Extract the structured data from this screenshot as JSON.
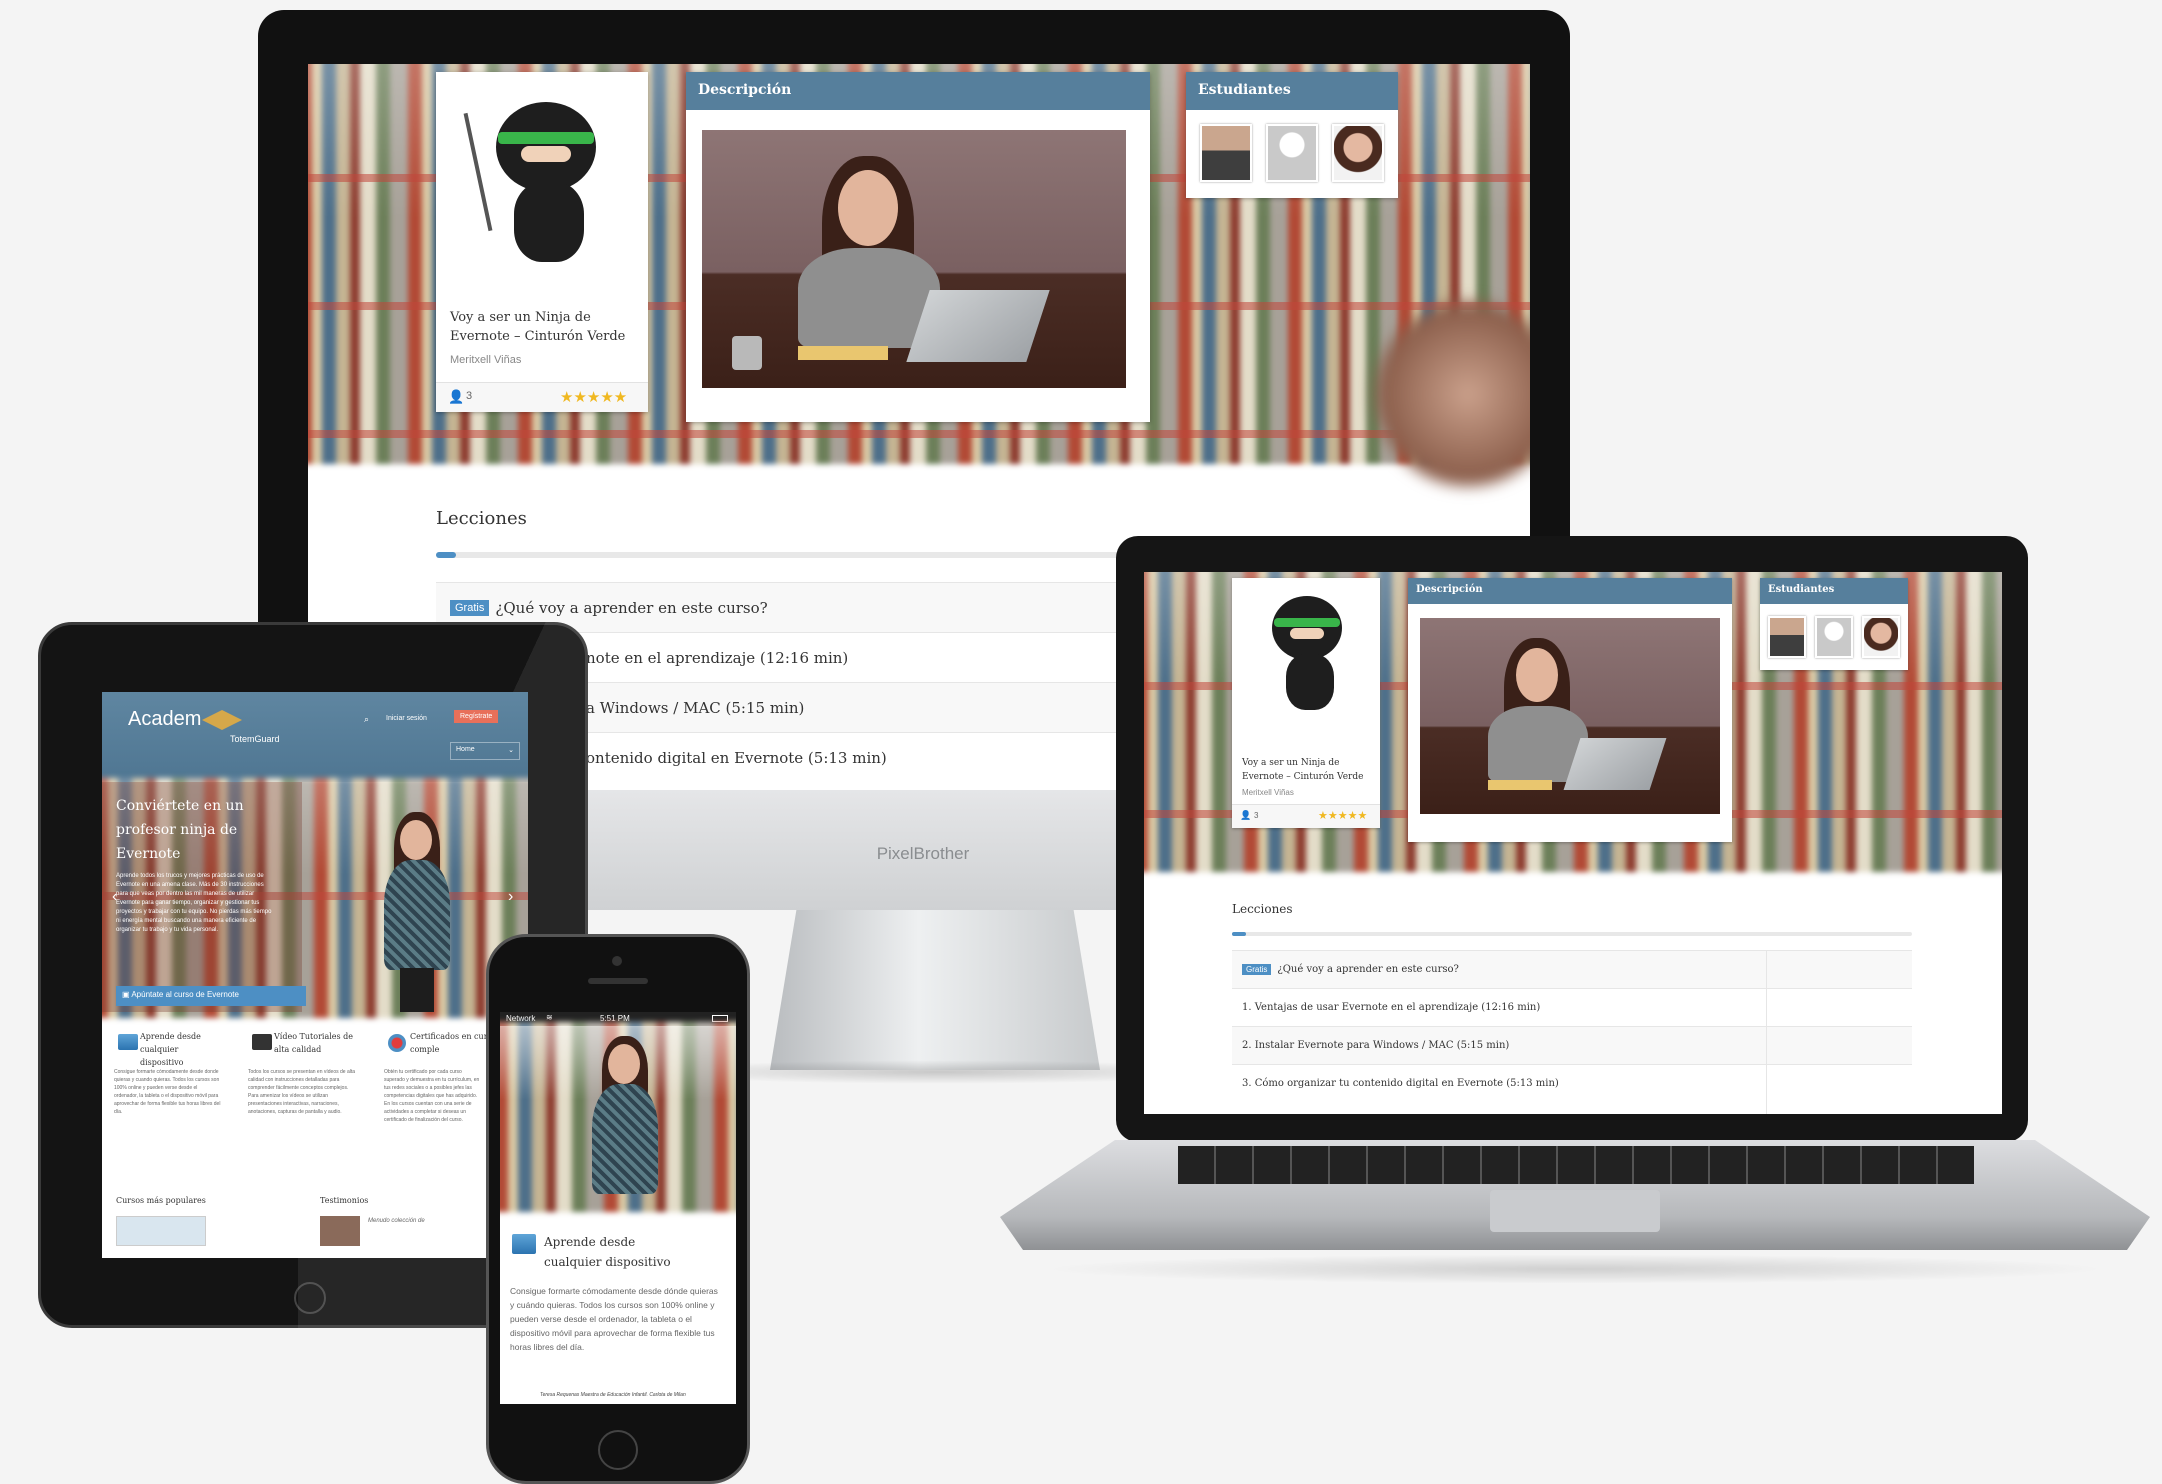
{
  "course": {
    "title": "Voy a ser un Ninja de Evernote – Cinturón Verde",
    "author": "Meritxell Viñas",
    "students_count": "3",
    "rating": "★★★★★",
    "description_label": "Descripción",
    "students_label": "Estudiantes"
  },
  "lessons": {
    "heading": "Lecciones",
    "free_badge": "Gratis",
    "items": [
      "¿Qué voy a aprender en este curso?",
      "1. Ventajas de usar Evernote en el aprendizaje (12:16 min)",
      "2. Instalar Evernote para Windows / MAC (5:15 min)",
      "3. Cómo organizar tu contenido digital en Evernote (5:13 min)"
    ],
    "desktop_visible": [
      "¿Qué voy a aprender en este curso?",
      "note en el aprendizaje (12:16 min)",
      "a Windows / MAC (5:15 min)",
      "ontenido digital en Evernote (5:13 min)"
    ]
  },
  "monitor": {
    "brand": "PixelBrother"
  },
  "tablet": {
    "logo_main": "Academ",
    "logo_sub": "TotemGuard",
    "login": "Iniciar sesión",
    "register": "Regístrate",
    "nav_select": "Home",
    "hero_title": "Conviértete en un profesor ninja de Evernote",
    "hero_text": "Aprende todos los trucos y mejores prácticas de uso de Evernote en una amena clase. Más de 30 instrucciones para que veas por dentro las mil maneras de utilizar Evernote para ganar tiempo, organizar y gestionar tus proyectos y trabajar con tu equipo. No pierdas más tiempo ni energía mental buscando una manera eficiente de organizar tu trabajo y tu vida personal.",
    "cta": "Apúntate al curso de Evernote",
    "features": [
      {
        "title": "Aprende desde cualquier dispositivo",
        "text": "Consigue formarte cómodamente desde donde quieras y cuando quieras. Todos los cursos son 100% online y pueden verse desde el ordenador, la tableta o el dispositivo móvil para aprovechar de forma flexible tus horas libres del día."
      },
      {
        "title": "Vídeo Tutoriales de alta calidad",
        "text": "Todos los cursos se presentan en vídeos de alta calidad con instrucciones detalladas para comprender fácilmente conceptos complejos. Para amenizar los vídeos se utilizan presentaciones interactivas, narraciones, anotaciones, capturas de pantalla y audio."
      },
      {
        "title": "Certificados en cursos comple",
        "text": "Obtén tu certificado por cada curso superado y demuestra en tu currículum, en tus redes sociales o a posibles jefes las competencias digitales que has adquirido. En los cursos cuentan con una serie de actividades a completar si deseas un certificado de finalización del curso."
      }
    ],
    "popular": "Cursos más populares",
    "testimonials": "Testimonios",
    "testimonial_snip": "Menudo colección de"
  },
  "phone": {
    "carrier": "Network",
    "time": "5:51 PM",
    "feature_title": "Aprende desde cualquier dispositivo",
    "feature_text": "Consigue formarte cómodamente desde dónde quieras y cuándo quieras. Todos los cursos son 100% online y pueden verse desde el ordenador, la tableta o el dispositivo móvil para aprovechar de forma flexible tus horas libres del día.",
    "footer_snip": "Teresa Requenas Maestra de Educación Infantil. Carlota de Milan"
  }
}
